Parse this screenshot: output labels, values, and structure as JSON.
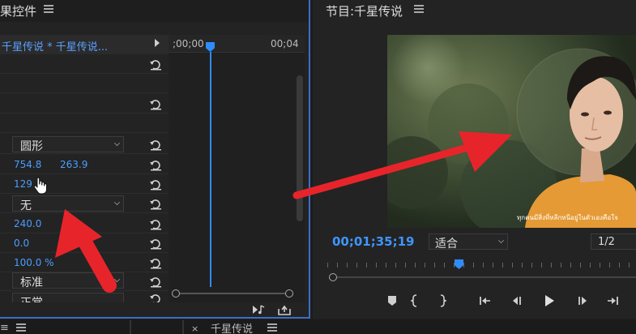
{
  "effect_controls": {
    "tab_title": "果控件",
    "clip_label": "千星传说 * 千星传说...",
    "timeline_start": ";00;00",
    "timeline_end": "00;04",
    "props": {
      "shape": "圆形",
      "pos_x": "754.8",
      "pos_y": "263.9",
      "angle": "129",
      "feather_mode": "无",
      "value_a": "240.0",
      "value_b": "0.0",
      "opacity": "100.0 %",
      "blend": "标准",
      "partial": "正常"
    }
  },
  "program_monitor": {
    "title": "节目:千星传说",
    "subtitle_text": "ทุกคนมีสิ่งที่หลีกหนีอยู่ในตัวเองคือใจ",
    "timecode": "00;01;35;19",
    "fit": "适合",
    "resolution": "1/2"
  },
  "bottom": {
    "tab_label": "千星传说"
  },
  "icons": [
    "menu-icon",
    "reset-icon",
    "play-icon",
    "marker-icon",
    "in-point-icon",
    "out-point-icon",
    "go-to-in-icon",
    "step-back-icon",
    "step-forward-icon",
    "go-to-out-icon",
    "export-frame-icon",
    "audio-icon"
  ],
  "colors": {
    "accent": "#2f8cff",
    "value_blue": "#4b9dff",
    "arrow_red": "#e8242b"
  }
}
